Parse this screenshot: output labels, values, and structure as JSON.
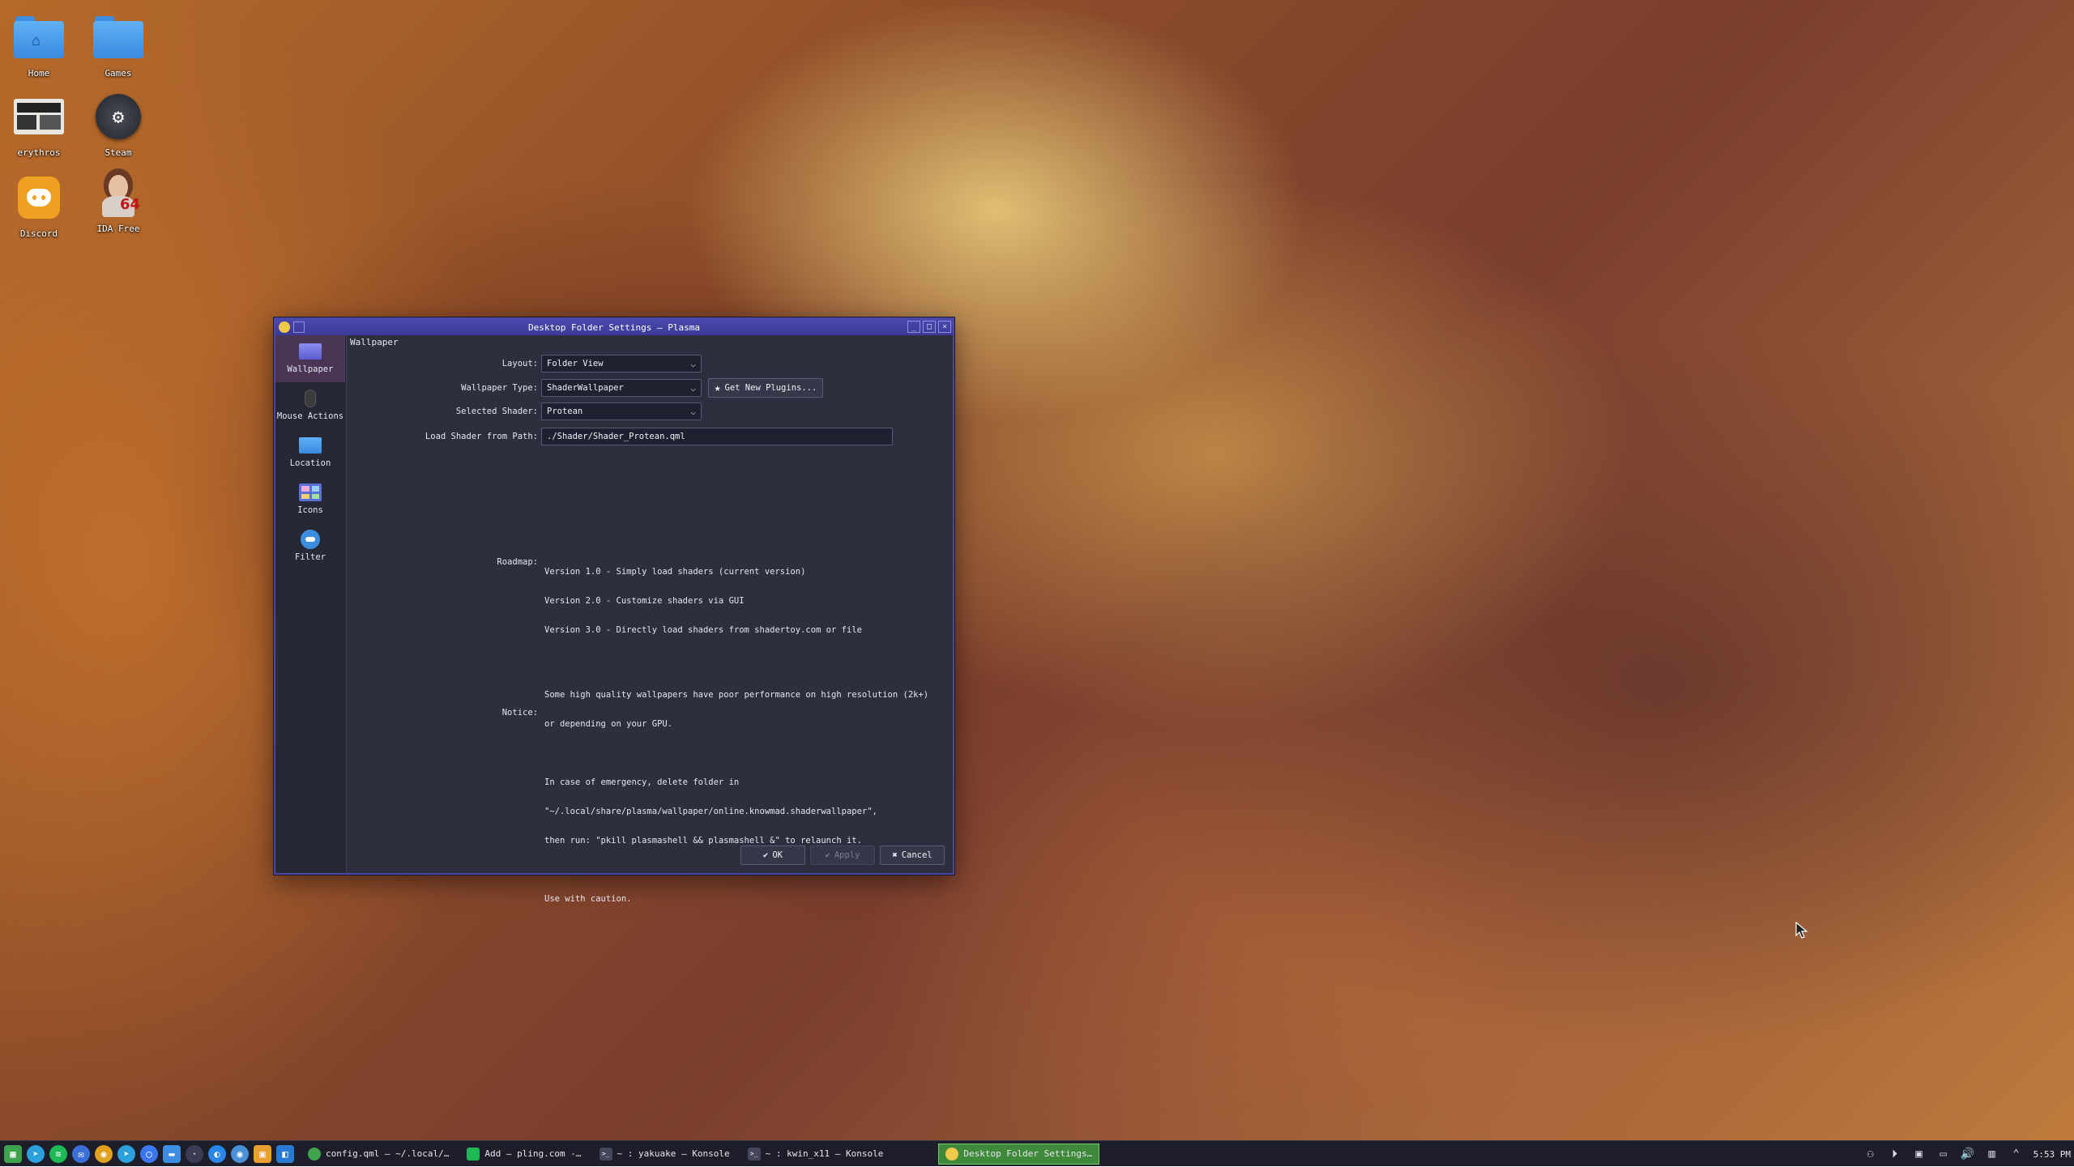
{
  "desktop": {
    "icons": [
      {
        "label": "Home",
        "icon": "home-folder-icon"
      },
      {
        "label": "Games",
        "icon": "folder-icon"
      },
      {
        "label": "erythros",
        "icon": "terminal-thumbnail-icon"
      },
      {
        "label": "Steam",
        "icon": "steam-icon"
      },
      {
        "label": "Discord",
        "icon": "discord-icon"
      },
      {
        "label": "IDA Free",
        "icon": "ida-icon"
      }
    ]
  },
  "dialog": {
    "title": "Desktop Folder Settings — Plasma",
    "title_buttons": [
      "_",
      "□",
      "×"
    ],
    "sidebar": [
      {
        "label": "Wallpaper",
        "icon": "wallpaper-icon",
        "active": true
      },
      {
        "label": "Mouse Actions",
        "icon": "mouse-icon",
        "active": false
      },
      {
        "label": "Location",
        "icon": "folder-icon",
        "active": false
      },
      {
        "label": "Icons",
        "icon": "icons-grid-icon",
        "active": false
      },
      {
        "label": "Filter",
        "icon": "filter-icon",
        "active": false
      }
    ],
    "section_title": "Wallpaper",
    "form": {
      "layout_label": "Layout:",
      "layout_value": "Folder View",
      "wallpaper_type_label": "Wallpaper Type:",
      "wallpaper_type_value": "ShaderWallpaper",
      "get_plugins_label": "Get New Plugins...",
      "selected_shader_label": "Selected Shader:",
      "selected_shader_value": "Protean",
      "load_path_label": "Load Shader from Path:",
      "load_path_value": "./Shader/Shader_Protean.qml"
    },
    "roadmap": {
      "label": "Roadmap:",
      "lines": [
        "Version 1.0 - Simply load shaders (current version)",
        "Version 2.0 - Customize shaders via GUI",
        "Version 3.0 - Directly load shaders from shadertoy.com or file"
      ]
    },
    "notice": {
      "label": "Notice:",
      "lines": [
        "Some high quality wallpapers have poor performance on high resolution (2k+)",
        "or depending on your GPU.",
        "",
        "In case of emergency, delete folder in",
        "\"~/.local/share/plasma/wallpaper/online.knowmad.shaderwallpaper\",",
        "then run: \"pkill plasmashell && plasmashell &\" to relaunch it.",
        "",
        "Use with caution."
      ]
    },
    "buttons": {
      "ok": "OK",
      "apply": "Apply",
      "cancel": "Cancel"
    }
  },
  "taskbar": {
    "launchers": [
      {
        "icon": "app-menu-icon",
        "color": "#3fa34d"
      },
      {
        "icon": "telegram-icon",
        "color": "#2aa1da"
      },
      {
        "icon": "spotify-icon",
        "color": "#1db954"
      },
      {
        "icon": "thunderbird-icon",
        "color": "#3a6fd8"
      },
      {
        "icon": "chrome-icon",
        "color": "#e0a020"
      },
      {
        "icon": "telegram-alt-icon",
        "color": "#2aa1da"
      },
      {
        "icon": "signal-icon",
        "color": "#3a76f0"
      },
      {
        "icon": "files-icon",
        "color": "#3d8ee0"
      },
      {
        "icon": "dot-icon",
        "color": "#3a3c55"
      },
      {
        "icon": "messenger-icon",
        "color": "#2a86e8"
      },
      {
        "icon": "chromium-icon",
        "color": "#4a90d9"
      },
      {
        "icon": "calendar-icon",
        "color": "#e8a030"
      },
      {
        "icon": "vscode-icon",
        "color": "#2a7ad4"
      }
    ],
    "tasks": [
      {
        "label": "config.qml — ~/.local/…",
        "icon": "chrome-task-icon",
        "color": "#3fa34d",
        "active": false
      },
      {
        "label": "Add — pling.com -…",
        "icon": "spotify-task-icon",
        "color": "#1db954",
        "active": false
      },
      {
        "label": "~ : yakuake — Konsole",
        "icon": "konsole-icon",
        "color": "#44465c",
        "active": false
      },
      {
        "label": "~ : kwin_x11 — Konsole",
        "icon": "konsole-icon",
        "color": "#44465c",
        "active": false
      },
      {
        "label": "Desktop Folder Settings…",
        "icon": "plasma-settings-icon",
        "color": "#f2c84b",
        "active": true
      }
    ],
    "clock": "5:53 PM"
  }
}
